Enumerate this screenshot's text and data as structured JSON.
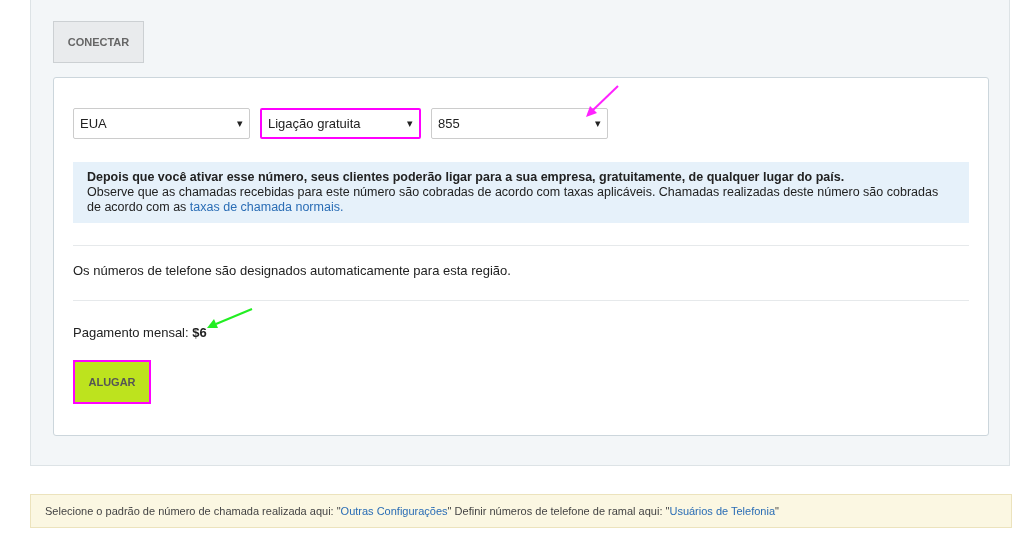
{
  "connect_button": {
    "label": "CONECTAR"
  },
  "selects": [
    {
      "value": "EUA",
      "highlighted": false
    },
    {
      "value": "Ligação gratuita",
      "highlighted": true
    },
    {
      "value": "855",
      "highlighted": false
    }
  ],
  "select_caret": "▾",
  "info": {
    "title": "Depois que você ativar esse número, seus clientes poderão ligar para a sua empresa, gratuitamente, de qualquer lugar do país.",
    "text": "Observe que as chamadas recebidas para este número são cobradas de acordo com taxas aplicáveis. Chamadas realizadas deste número são cobradas de acordo com as ",
    "link": "taxas de chamada normais."
  },
  "assignment_note": "Os números de telefone são designados automaticamente para esta região.",
  "monthly_payment": {
    "label": "Pagamento mensal:",
    "amount": "$6"
  },
  "rent_button": {
    "label": "ALUGAR",
    "highlighted": true
  },
  "footer_note": [
    {
      "kind": "text",
      "text": "Selecione o padrão de número de chamada realizada aqui: \""
    },
    {
      "kind": "link",
      "text": "Outras Configurações"
    },
    {
      "kind": "text",
      "text": "\" Definir números de telefone de ramal aqui: \""
    },
    {
      "kind": "link",
      "text": "Usuários de Telefonia"
    },
    {
      "kind": "text",
      "text": "\""
    }
  ]
}
